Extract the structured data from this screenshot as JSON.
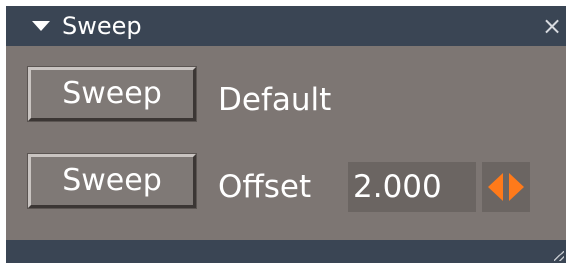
{
  "panel": {
    "title": "Sweep",
    "collapse_icon": "triangle-down-icon",
    "close_icon": "close-icon",
    "close_glyph": "×"
  },
  "rows": [
    {
      "button_label": "Sweep",
      "label": "Default"
    },
    {
      "button_label": "Sweep",
      "label": "Offset",
      "value": "2.000",
      "stepper_icons": [
        "arrow-left-icon",
        "arrow-right-icon"
      ]
    }
  ],
  "colors": {
    "panel_bg": "#7d7673",
    "titlebar_bg": "#3a4554",
    "accent": "#ff7a1a"
  }
}
